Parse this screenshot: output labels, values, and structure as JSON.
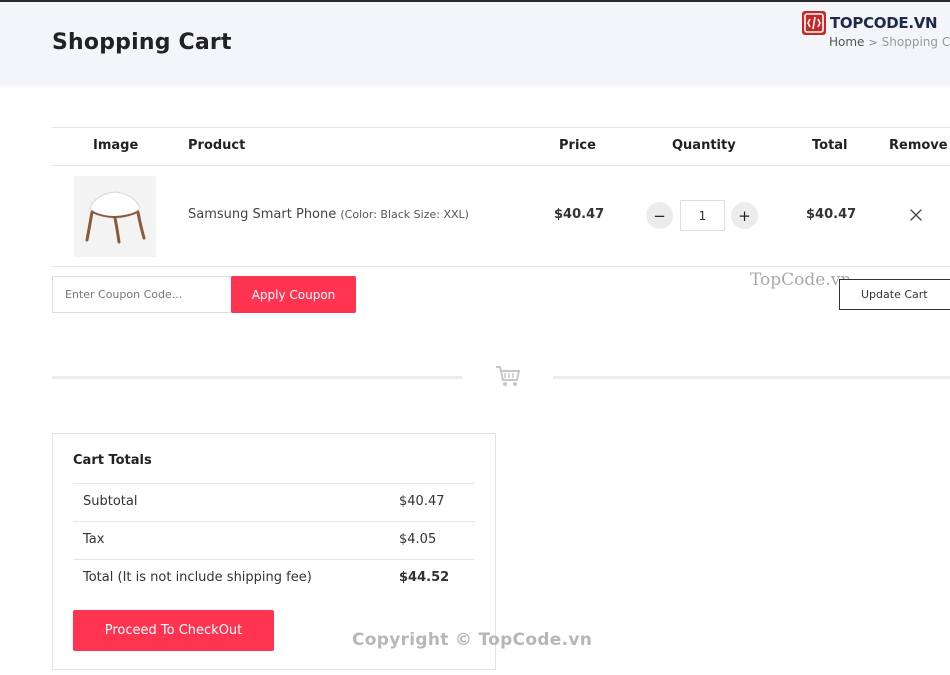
{
  "header": {
    "title": "Shopping Cart",
    "breadcrumb": {
      "home": "Home",
      "separator": ">",
      "current": "Shopping Cart"
    },
    "logo_text": "TOPCODE.VN"
  },
  "table": {
    "headers": {
      "image": "Image",
      "product": "Product",
      "price": "Price",
      "quantity": "Quantity",
      "total": "Total",
      "remove": "Remove"
    },
    "rows": [
      {
        "name": "Samsung Smart Phone",
        "variant": "(Color: Black Size: XXL)",
        "price": "$40.47",
        "quantity": "1",
        "total": "$40.47",
        "decrement_label": "−",
        "increment_label": "+"
      }
    ]
  },
  "coupon": {
    "placeholder": "Enter Coupon Code...",
    "apply_label": "Apply Coupon"
  },
  "update_label": "Update Cart",
  "watermarks": {
    "middle": "TopCode.vn",
    "bottom": "Copyright © TopCode.vn"
  },
  "cart_totals": {
    "title": "Cart Totals",
    "rows": [
      {
        "label": "Subtotal",
        "value": "$40.47"
      },
      {
        "label": "Tax",
        "value": "$4.05"
      },
      {
        "label": "Total (It is not include shipping fee)",
        "value": "$44.52"
      }
    ],
    "checkout_label": "Proceed To CheckOut"
  },
  "colors": {
    "accent": "#ff3451",
    "header_bg": "#f4f5f9",
    "logo_red": "#c62828",
    "logo_navy": "#1e2a4a"
  },
  "icons": {
    "remove": "close-icon",
    "divider": "cart-icon",
    "logo": "topcode-logo-icon",
    "breadcrumb_sep": "chevron-right-icon"
  }
}
